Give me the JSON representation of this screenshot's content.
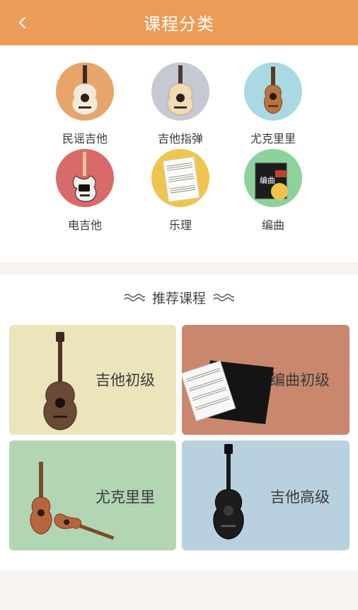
{
  "header": {
    "title": "课程分类",
    "back_icon": "chevron-left-icon"
  },
  "categories": [
    {
      "label": "民谣吉他",
      "bg": "#e7a56a",
      "icon": "acoustic-guitar-icon"
    },
    {
      "label": "吉他指弹",
      "bg": "#c6c8d3",
      "icon": "acoustic-guitar-icon"
    },
    {
      "label": "尤克里里",
      "bg": "#a9d9e1",
      "icon": "ukulele-icon"
    },
    {
      "label": "电吉他",
      "bg": "#d96a6a",
      "icon": "electric-guitar-icon"
    },
    {
      "label": "乐理",
      "bg": "#eec64f",
      "icon": "sheet-music-icon"
    },
    {
      "label": "编曲",
      "bg": "#8fd19c",
      "icon": "arrangement-book-icon",
      "badge": "编曲"
    }
  ],
  "recommended": {
    "title": "推荐课程",
    "cards": [
      {
        "name": "吉他初级",
        "bg": "#ece4bb",
        "icon": "acoustic-guitar-icon"
      },
      {
        "name": "编曲初级",
        "bg": "#c9886e",
        "icon": "sheet-music-folder-icon"
      },
      {
        "name": "尤克里里",
        "bg": "#b2d6b4",
        "icon": "ukulele-icon"
      },
      {
        "name": "吉他高级",
        "bg": "#b9d1df",
        "icon": "black-guitar-icon"
      }
    ]
  }
}
